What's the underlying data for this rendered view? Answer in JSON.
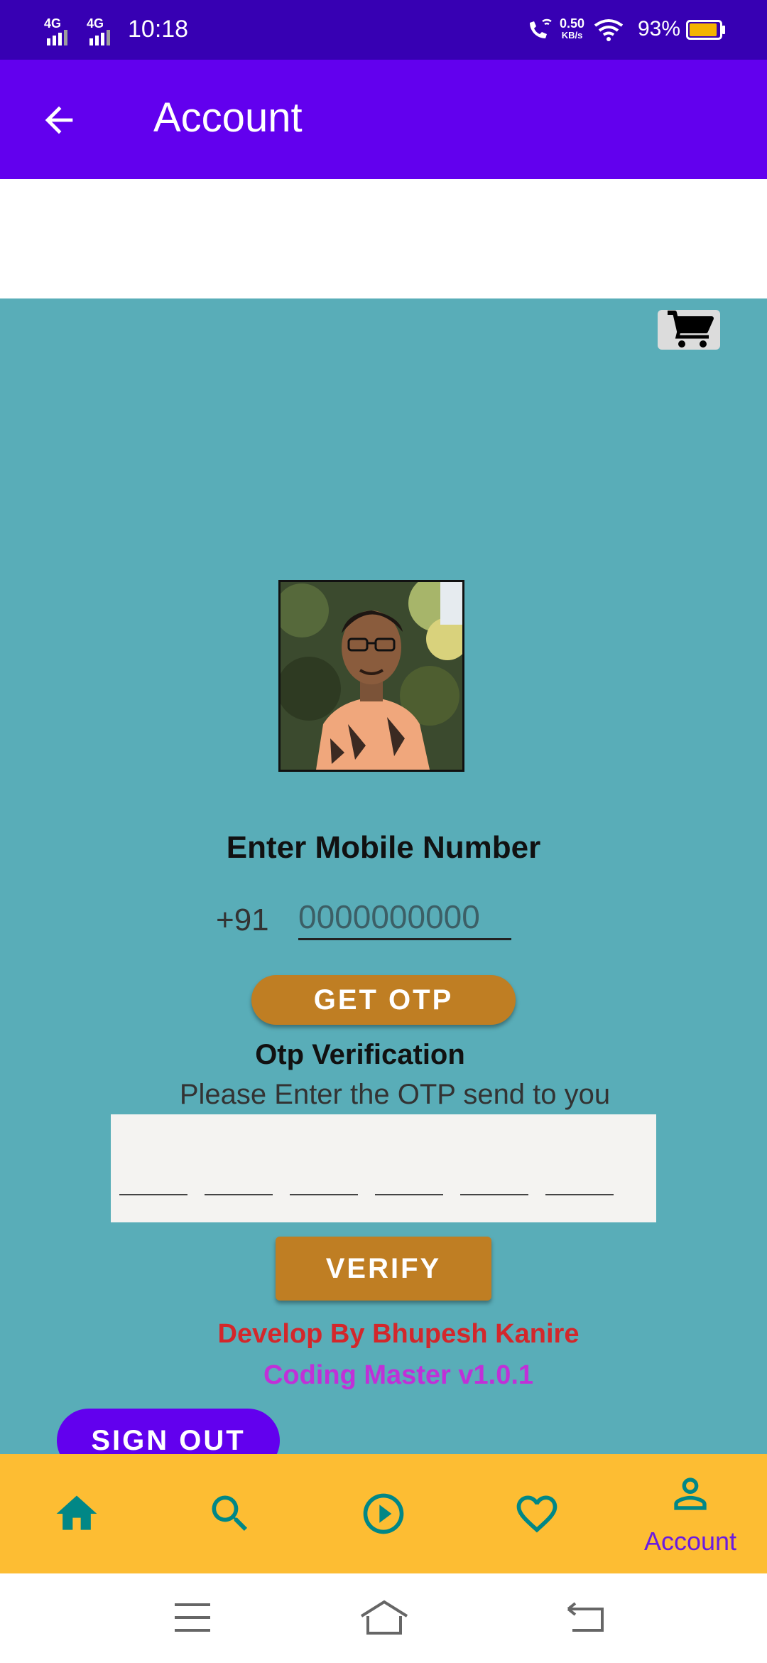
{
  "status_bar": {
    "network_1": "4G",
    "network_2": "4G",
    "time": "10:18",
    "data_speed_value": "0.50",
    "data_speed_unit": "KB/s",
    "battery": "93%",
    "battery_level": 0.93,
    "icons": [
      "signal-icon",
      "signal-icon",
      "wifi-calling-icon",
      "wifi-icon",
      "battery-icon"
    ]
  },
  "app_bar": {
    "title": "Account",
    "back_icon": "arrow-back-icon"
  },
  "cart_icon": "shopping-cart-icon",
  "mobile": {
    "heading": "Enter Mobile Number",
    "country_code": "+91",
    "placeholder": "0000000000",
    "button": "GET OTP"
  },
  "otp": {
    "heading": "Otp Verification",
    "subtext": "Please Enter the OTP send to you",
    "digits": [
      "",
      "",
      "",
      "",
      "",
      ""
    ],
    "button": "VERIFY"
  },
  "footer": {
    "developer": "Develop By Bhupesh Kanire",
    "version": "Coding Master v1.0.1",
    "sign_out": "SIGN OUT"
  },
  "bottom_nav": {
    "items": [
      {
        "icon": "home-icon",
        "label": ""
      },
      {
        "icon": "search-icon",
        "label": ""
      },
      {
        "icon": "play-icon",
        "label": ""
      },
      {
        "icon": "heart-icon",
        "label": ""
      },
      {
        "icon": "person-icon",
        "label": "Account"
      }
    ],
    "active_index": 4
  },
  "colors": {
    "status_bar": "#3700b3",
    "app_bar": "#6200ee",
    "content_bg": "#59adb8",
    "button": "#bf7e23",
    "nav_bg": "#fdbd33",
    "nav_icon": "#018786",
    "nav_active": "#6a1be0",
    "developer_text": "#d3272b",
    "version_text": "#c030d8"
  },
  "system_nav": [
    "menu-icon",
    "home-outline-icon",
    "back-icon"
  ]
}
